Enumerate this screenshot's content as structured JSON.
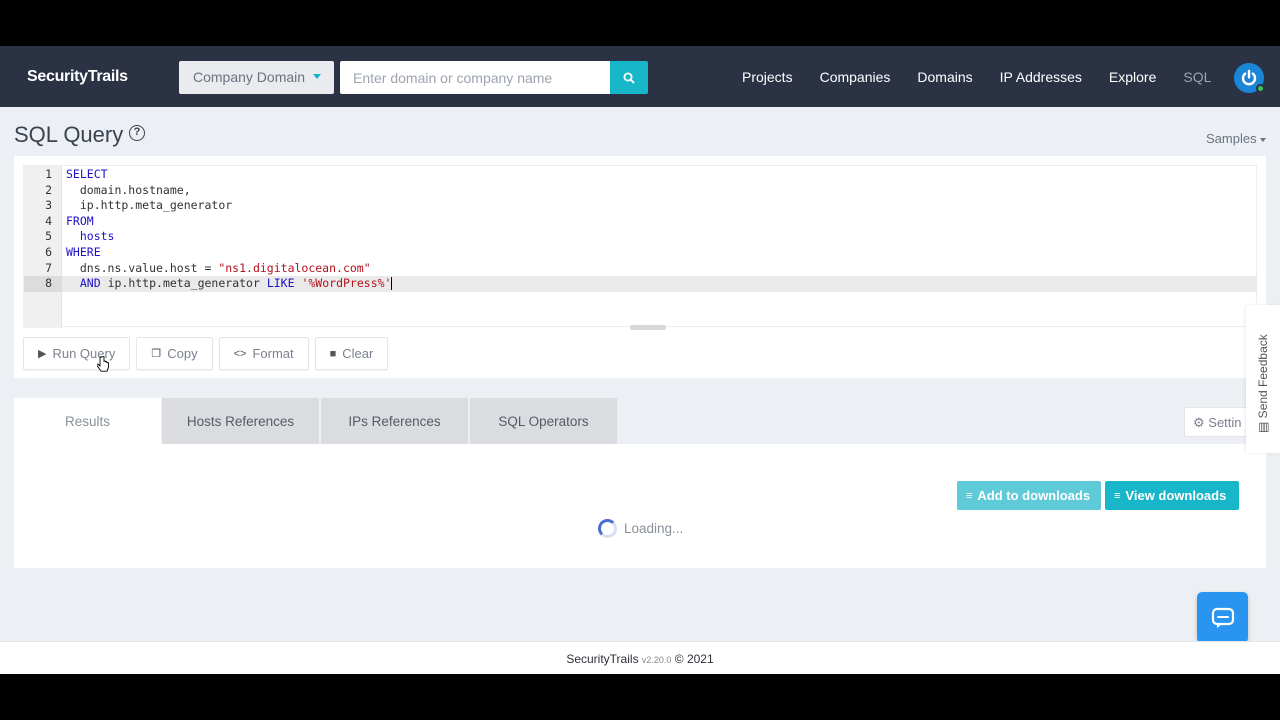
{
  "navbar": {
    "brand": "SecurityTrails",
    "search_type": "Company Domain",
    "search_placeholder": "Enter domain or company name",
    "links": [
      "Projects",
      "Companies",
      "Domains",
      "IP Addresses",
      "Explore",
      "SQL"
    ],
    "active_link": "SQL"
  },
  "page": {
    "title": "SQL Query",
    "samples_label": "Samples"
  },
  "editor": {
    "line_numbers": [
      "1",
      "2",
      "3",
      "4",
      "5",
      "6",
      "7",
      "8"
    ],
    "lines": [
      [
        {
          "t": "SELECT",
          "c": "kw"
        }
      ],
      [
        {
          "t": "  domain.hostname,",
          "c": ""
        }
      ],
      [
        {
          "t": "  ip.http.meta_generator",
          "c": ""
        }
      ],
      [
        {
          "t": "FROM",
          "c": "kw"
        }
      ],
      [
        {
          "t": "  hosts",
          "c": "kw"
        }
      ],
      [
        {
          "t": "WHERE",
          "c": "kw"
        }
      ],
      [
        {
          "t": "  dns.ns.value.host = ",
          "c": ""
        },
        {
          "t": "\"ns1.digitalocean.com\"",
          "c": "str"
        }
      ],
      [
        {
          "t": "  ",
          "c": ""
        },
        {
          "t": "AND",
          "c": "kw"
        },
        {
          "t": " ip.http.meta_generator ",
          "c": ""
        },
        {
          "t": "LIKE",
          "c": "kw"
        },
        {
          "t": " ",
          "c": ""
        },
        {
          "t": "'%WordPress%'",
          "c": "str"
        }
      ]
    ],
    "active_line": 8
  },
  "toolbar": {
    "run": "Run Query",
    "copy": "Copy",
    "format": "Format",
    "clear": "Clear"
  },
  "tabs": [
    "Results",
    "Hosts References",
    "IPs References",
    "SQL Operators"
  ],
  "active_tab": "Results",
  "settings_label": "Settin",
  "downloads": {
    "add": "Add to downloads",
    "view": "View downloads"
  },
  "loading_text": "Loading...",
  "feedback_label": "Send Feedback",
  "footer": {
    "brand": "SecurityTrails",
    "version": "v2.20.0",
    "copyright": "© 2021"
  },
  "colors": {
    "navbar_bg": "#2a3244",
    "accent": "#17b6c9",
    "chat": "#2a95f0"
  }
}
